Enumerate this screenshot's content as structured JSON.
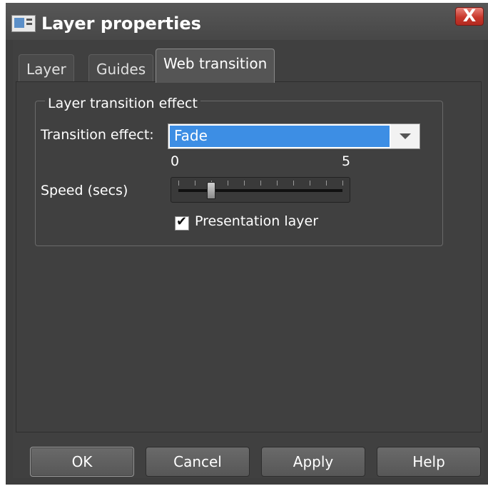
{
  "window": {
    "title": "Layer properties",
    "close_label": "X"
  },
  "tabs": [
    {
      "label": "Layer",
      "active": false
    },
    {
      "label": "Guides",
      "active": false
    },
    {
      "label": "Web transition",
      "active": true
    }
  ],
  "group": {
    "legend": "Layer transition effect",
    "transition_label": "Transition effect:",
    "transition_value": "Fade",
    "speed_label": "Speed (secs)",
    "speed_min": "0",
    "speed_max": "5",
    "speed_value": 1,
    "presentation_label": "Presentation layer",
    "presentation_checked": true
  },
  "buttons": {
    "ok": "OK",
    "cancel": "Cancel",
    "apply": "Apply",
    "help": "Help"
  },
  "colors": {
    "accent": "#3d8ee4",
    "dialog_bg": "#404040",
    "close": "#c8382c"
  }
}
